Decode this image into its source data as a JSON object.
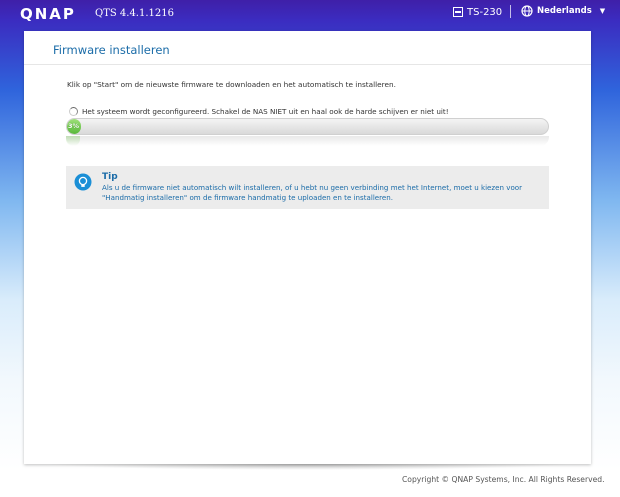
{
  "header": {
    "logo": "QNAP",
    "version": "QTS 4.4.1.1216",
    "model": "TS-230",
    "language": "Nederlands"
  },
  "panel": {
    "title": "Firmware installeren",
    "intro": "Klik op \"Start\" om de nieuwste firmware te downloaden en het automatisch te installeren.",
    "status": "Het systeem wordt geconfigureerd. Schakel de NAS NIET uit en haal ook de harde schijven er niet uit!",
    "progress": {
      "label": "3%",
      "percent": 3
    },
    "tip": {
      "title": "Tip",
      "text": "Als u de firmware niet automatisch wilt installeren, of u hebt nu geen verbinding met het Internet, moet u kiezen voor \"Handmatig installeren\" om de firmware handmatig te uploaden en te installeren."
    }
  },
  "footer": {
    "copyright": "Copyright © QNAP Systems, Inc. All Rights Reserved."
  },
  "colors": {
    "accent": "#1b6ca8",
    "progress_green": "#58b83a",
    "tip_background": "#ececec"
  }
}
